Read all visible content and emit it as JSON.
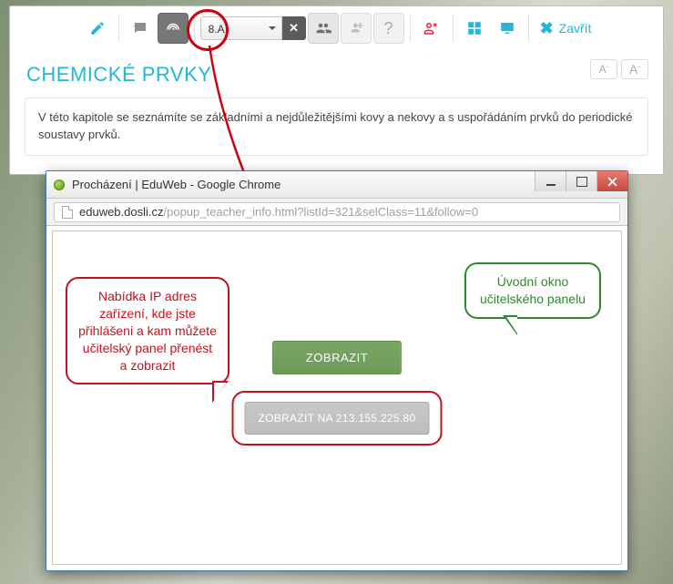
{
  "toolbar": {
    "class_selected": "8.A",
    "close_label": "Zavřít"
  },
  "page": {
    "title": "CHEMICKÉ PRVKY",
    "font_small_label": "A",
    "font_large_label": "A",
    "description": "V této kapitole se seznámíte se základními a nejdůležitějšími kovy a nekovy a s uspořádáním prvků do periodické soustavy prvků."
  },
  "popup": {
    "window_title": "Procházení | EduWeb - Google Chrome",
    "url_domain": "eduweb.dosli.cz",
    "url_rest": "/popup_teacher_info.html?listId=321&selClass=11&follow=0",
    "btn_show": "ZOBRAZIT",
    "btn_show_ip": "ZOBRAZIT NA 213.155.225.80"
  },
  "callouts": {
    "ip_list": "Nabídka IP adres zařízení, kde jste přihlášeni a kam můžete učitelský panel přenést a zobrazit",
    "intro": "Úvodní okno učitelského panelu"
  }
}
